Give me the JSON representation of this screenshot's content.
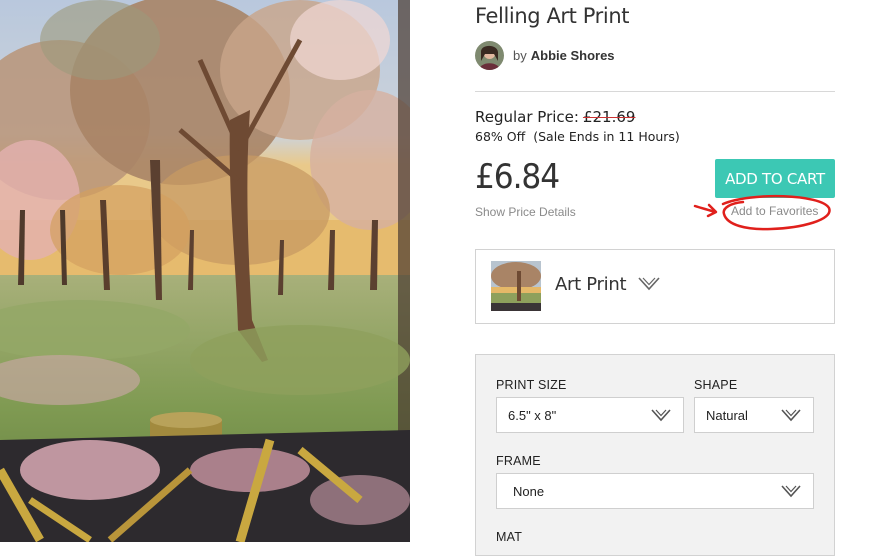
{
  "product": {
    "title": "Felling Art Print",
    "artist_prefix": "by",
    "artist_name": "Abbie Shores"
  },
  "pricing": {
    "regular_label": "Regular Price:",
    "regular_price": "£21.69",
    "discount": "68% Off",
    "sale_ends": "(Sale Ends in 11 Hours)",
    "price": "£6.84",
    "show_details": "Show Price Details"
  },
  "actions": {
    "add_to_cart": "ADD TO CART",
    "add_to_favorites": "Add to Favorites"
  },
  "product_type": {
    "label": "Art Print",
    "icon": "chevron-down-icon"
  },
  "options": {
    "print_size": {
      "label": "PRINT SIZE",
      "value": "6.5\" x 8\""
    },
    "shape": {
      "label": "SHAPE",
      "value": "Natural"
    },
    "frame": {
      "label": "FRAME",
      "value": "None"
    },
    "mat": {
      "label": "MAT"
    }
  },
  "colors": {
    "accent": "#3cc8b4",
    "annotation": "#e0201c",
    "muted_text": "#8a8a8a",
    "border": "#d2d2d2"
  }
}
